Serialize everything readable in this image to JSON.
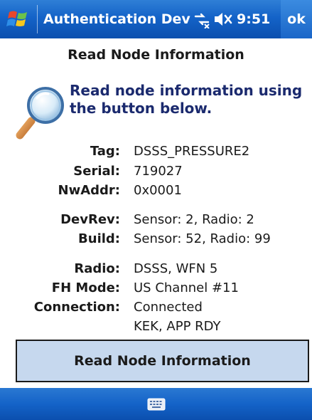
{
  "title_bar": {
    "start_icon": "windows-flag-icon",
    "title": "Authentication Dev",
    "connectivity_icon": "connectivity-icon",
    "volume_icon": "speaker-muted-icon",
    "time": "9:51",
    "ok_label": "ok"
  },
  "page": {
    "heading": "Read Node Information",
    "instruction": "Read node information using the button below.",
    "icon": "magnifier-icon"
  },
  "info": {
    "tag": {
      "label": "Tag:",
      "value": "DSSS_PRESSURE2"
    },
    "serial": {
      "label": "Serial:",
      "value": "719027"
    },
    "nwaddr": {
      "label": "NwAddr:",
      "value": "0x0001"
    },
    "devrev": {
      "label": "DevRev:",
      "value": "Sensor: 2, Radio: 2"
    },
    "build": {
      "label": "Build:",
      "value": "Sensor: 52, Radio: 99"
    },
    "radio": {
      "label": "Radio:",
      "value": "DSSS, WFN 5"
    },
    "fh_mode": {
      "label": "FH Mode:",
      "value": "US Channel #11"
    },
    "connection": {
      "label": "Connection:",
      "value": "Connected",
      "value2": "KEK, APP RDY"
    }
  },
  "action": {
    "read_button_label": "Read Node Information"
  },
  "bottom_bar": {
    "keyboard_icon": "keyboard-icon"
  },
  "colors": {
    "title_bar": "#1463c8",
    "instruction_text": "#1b2a6e",
    "button_fill": "#c6d8ee",
    "button_border": "#1a1a1a"
  }
}
